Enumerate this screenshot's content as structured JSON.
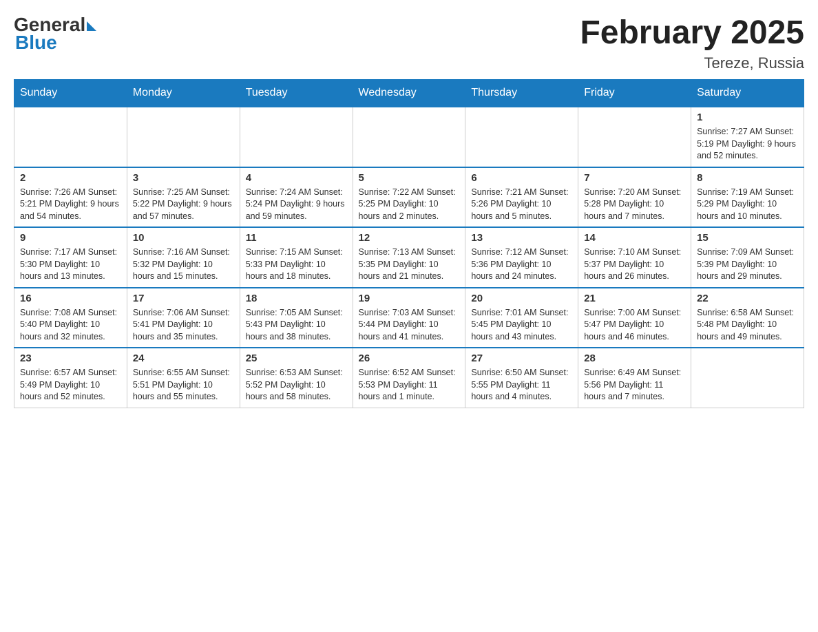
{
  "logo": {
    "general": "General",
    "blue": "Blue"
  },
  "title": "February 2025",
  "subtitle": "Tereze, Russia",
  "days_of_week": [
    "Sunday",
    "Monday",
    "Tuesday",
    "Wednesday",
    "Thursday",
    "Friday",
    "Saturday"
  ],
  "weeks": [
    [
      {
        "day": "",
        "info": ""
      },
      {
        "day": "",
        "info": ""
      },
      {
        "day": "",
        "info": ""
      },
      {
        "day": "",
        "info": ""
      },
      {
        "day": "",
        "info": ""
      },
      {
        "day": "",
        "info": ""
      },
      {
        "day": "1",
        "info": "Sunrise: 7:27 AM\nSunset: 5:19 PM\nDaylight: 9 hours and 52 minutes."
      }
    ],
    [
      {
        "day": "2",
        "info": "Sunrise: 7:26 AM\nSunset: 5:21 PM\nDaylight: 9 hours and 54 minutes."
      },
      {
        "day": "3",
        "info": "Sunrise: 7:25 AM\nSunset: 5:22 PM\nDaylight: 9 hours and 57 minutes."
      },
      {
        "day": "4",
        "info": "Sunrise: 7:24 AM\nSunset: 5:24 PM\nDaylight: 9 hours and 59 minutes."
      },
      {
        "day": "5",
        "info": "Sunrise: 7:22 AM\nSunset: 5:25 PM\nDaylight: 10 hours and 2 minutes."
      },
      {
        "day": "6",
        "info": "Sunrise: 7:21 AM\nSunset: 5:26 PM\nDaylight: 10 hours and 5 minutes."
      },
      {
        "day": "7",
        "info": "Sunrise: 7:20 AM\nSunset: 5:28 PM\nDaylight: 10 hours and 7 minutes."
      },
      {
        "day": "8",
        "info": "Sunrise: 7:19 AM\nSunset: 5:29 PM\nDaylight: 10 hours and 10 minutes."
      }
    ],
    [
      {
        "day": "9",
        "info": "Sunrise: 7:17 AM\nSunset: 5:30 PM\nDaylight: 10 hours and 13 minutes."
      },
      {
        "day": "10",
        "info": "Sunrise: 7:16 AM\nSunset: 5:32 PM\nDaylight: 10 hours and 15 minutes."
      },
      {
        "day": "11",
        "info": "Sunrise: 7:15 AM\nSunset: 5:33 PM\nDaylight: 10 hours and 18 minutes."
      },
      {
        "day": "12",
        "info": "Sunrise: 7:13 AM\nSunset: 5:35 PM\nDaylight: 10 hours and 21 minutes."
      },
      {
        "day": "13",
        "info": "Sunrise: 7:12 AM\nSunset: 5:36 PM\nDaylight: 10 hours and 24 minutes."
      },
      {
        "day": "14",
        "info": "Sunrise: 7:10 AM\nSunset: 5:37 PM\nDaylight: 10 hours and 26 minutes."
      },
      {
        "day": "15",
        "info": "Sunrise: 7:09 AM\nSunset: 5:39 PM\nDaylight: 10 hours and 29 minutes."
      }
    ],
    [
      {
        "day": "16",
        "info": "Sunrise: 7:08 AM\nSunset: 5:40 PM\nDaylight: 10 hours and 32 minutes."
      },
      {
        "day": "17",
        "info": "Sunrise: 7:06 AM\nSunset: 5:41 PM\nDaylight: 10 hours and 35 minutes."
      },
      {
        "day": "18",
        "info": "Sunrise: 7:05 AM\nSunset: 5:43 PM\nDaylight: 10 hours and 38 minutes."
      },
      {
        "day": "19",
        "info": "Sunrise: 7:03 AM\nSunset: 5:44 PM\nDaylight: 10 hours and 41 minutes."
      },
      {
        "day": "20",
        "info": "Sunrise: 7:01 AM\nSunset: 5:45 PM\nDaylight: 10 hours and 43 minutes."
      },
      {
        "day": "21",
        "info": "Sunrise: 7:00 AM\nSunset: 5:47 PM\nDaylight: 10 hours and 46 minutes."
      },
      {
        "day": "22",
        "info": "Sunrise: 6:58 AM\nSunset: 5:48 PM\nDaylight: 10 hours and 49 minutes."
      }
    ],
    [
      {
        "day": "23",
        "info": "Sunrise: 6:57 AM\nSunset: 5:49 PM\nDaylight: 10 hours and 52 minutes."
      },
      {
        "day": "24",
        "info": "Sunrise: 6:55 AM\nSunset: 5:51 PM\nDaylight: 10 hours and 55 minutes."
      },
      {
        "day": "25",
        "info": "Sunrise: 6:53 AM\nSunset: 5:52 PM\nDaylight: 10 hours and 58 minutes."
      },
      {
        "day": "26",
        "info": "Sunrise: 6:52 AM\nSunset: 5:53 PM\nDaylight: 11 hours and 1 minute."
      },
      {
        "day": "27",
        "info": "Sunrise: 6:50 AM\nSunset: 5:55 PM\nDaylight: 11 hours and 4 minutes."
      },
      {
        "day": "28",
        "info": "Sunrise: 6:49 AM\nSunset: 5:56 PM\nDaylight: 11 hours and 7 minutes."
      },
      {
        "day": "",
        "info": ""
      }
    ]
  ]
}
